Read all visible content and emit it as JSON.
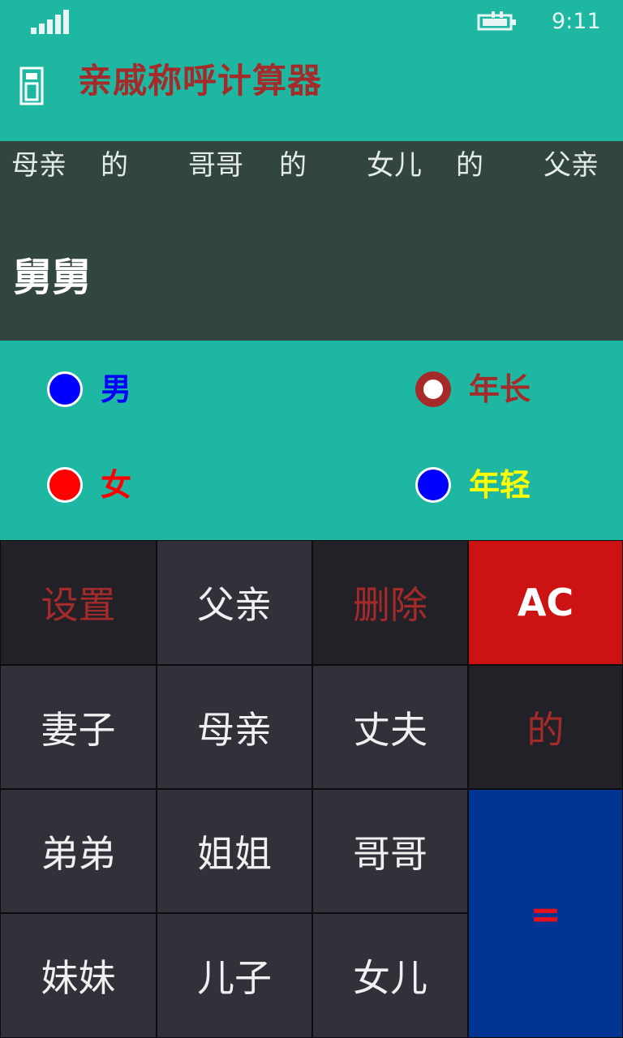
{
  "status_bar": {
    "time": "9:11",
    "signal_icon": "signal-bars-icon",
    "battery_icon": "battery-charging-icon"
  },
  "header": {
    "title": "亲戚称呼计算器",
    "icon": "calculator-icon"
  },
  "display": {
    "expression": [
      "母亲",
      "的",
      "哥哥",
      "的",
      "女儿",
      "的",
      "父亲"
    ],
    "result": "舅舅"
  },
  "options": {
    "male": {
      "label": "男",
      "color": "#0000ff"
    },
    "female": {
      "label": "女",
      "color": "#ff0000"
    },
    "older": {
      "label": "年长",
      "color": "#a52a2a"
    },
    "younger": {
      "label": "年轻",
      "color": "#ffff00"
    }
  },
  "keys": {
    "settings": "设置",
    "father": "父亲",
    "delete": "删除",
    "clear": "AC",
    "wife": "妻子",
    "mother": "母亲",
    "husband": "丈夫",
    "of": "的",
    "younger_brother": "弟弟",
    "older_sister": "姐姐",
    "older_brother": "哥哥",
    "equals": "=",
    "younger_sister": "妹妹",
    "son": "儿子",
    "daughter": "女儿"
  },
  "colors": {
    "background": "#1eb8a2",
    "display_bg": "#324540",
    "title": "#a52a2a",
    "ac_key": "#cc1212",
    "equals_key": "#003594"
  }
}
